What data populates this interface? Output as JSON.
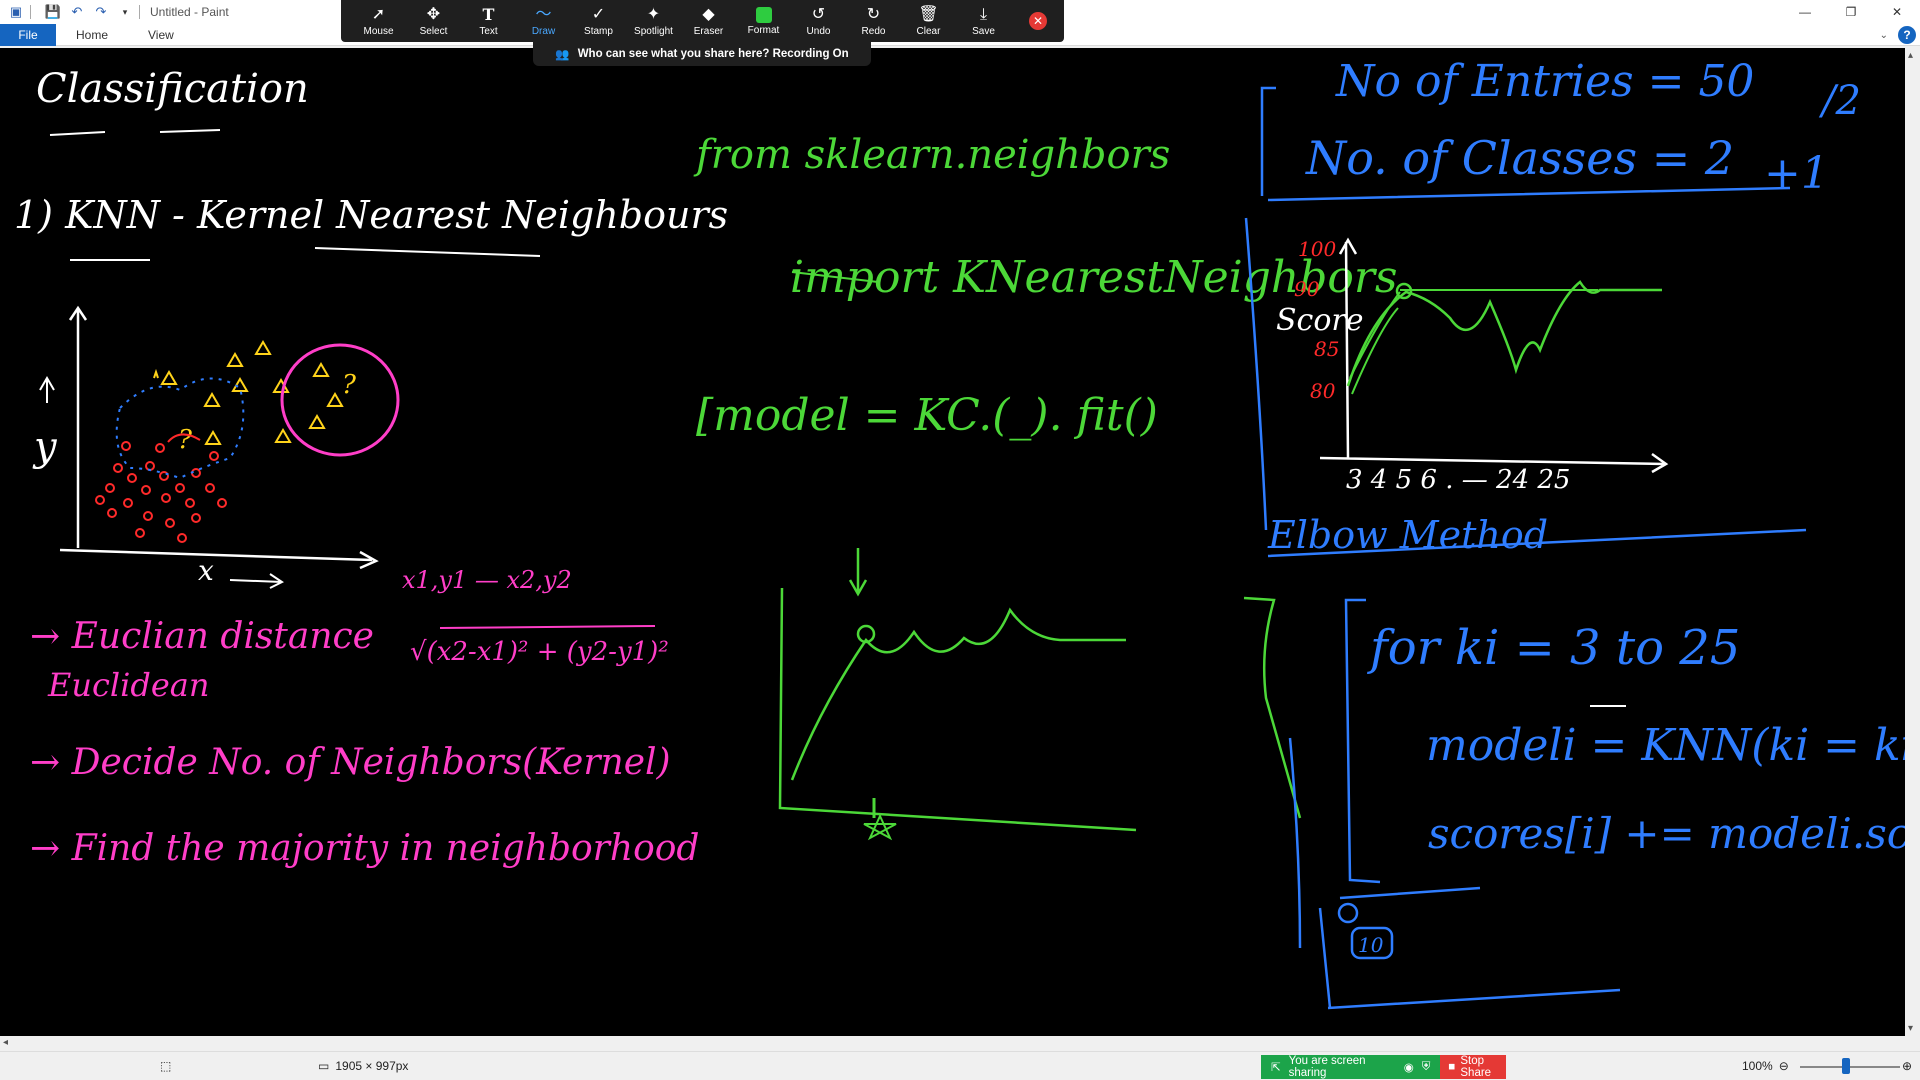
{
  "window": {
    "title": "Untitled - Paint",
    "controls": [
      "minimize",
      "restore",
      "close"
    ]
  },
  "ribbon": {
    "tabs": [
      "File",
      "Home",
      "View"
    ]
  },
  "zoom_toolbar": {
    "tools": [
      {
        "label": "Mouse",
        "icon": "cursor-icon"
      },
      {
        "label": "Select",
        "icon": "move-icon"
      },
      {
        "label": "Text",
        "icon": "text-icon"
      },
      {
        "label": "Draw",
        "icon": "draw-icon",
        "active": true
      },
      {
        "label": "Stamp",
        "icon": "stamp-icon"
      },
      {
        "label": "Spotlight",
        "icon": "spotlight-icon"
      },
      {
        "label": "Eraser",
        "icon": "eraser-icon"
      },
      {
        "label": "Format",
        "icon": "format-swatch-icon"
      },
      {
        "label": "Undo",
        "icon": "undo-icon"
      },
      {
        "label": "Redo",
        "icon": "redo-icon"
      },
      {
        "label": "Clear",
        "icon": "trash-icon"
      },
      {
        "label": "Save",
        "icon": "save-icon"
      }
    ],
    "sharing_notice": "Who can see what you share here? Recording On"
  },
  "canvas_text": {
    "heading": "Classification",
    "knn_title": "1) KNN - Kernel Nearest Neighbours",
    "axis_x": "x",
    "axis_y": "y",
    "coord_note": "x1,y1 — x2,y2",
    "bullet_1": "→ Euclian distance",
    "formula": "√(x2-x1)² + (y2-y1)²",
    "euclidean": "Euclidean",
    "bullet_2": "→ Decide No. of Neighbors(Kernel)",
    "bullet_3": "→ Find the majority in neighborhood",
    "code_1": "from sklearn.neighbors",
    "code_2": "import KNearestNeighbors",
    "code_3": "[model = KC.(_). fit()",
    "entries": "No of Entries = 50",
    "entries_note": "/2",
    "classes": "No. of Classes = 2",
    "classes_note": "+1",
    "score_label": "Score",
    "score_ticks": [
      "100",
      "90",
      "85",
      "80"
    ],
    "x_ticks": "3 4 5 6 . — 24 25",
    "elbow": "Elbow Method",
    "loop_1": "for ki = 3 to 25",
    "loop_2": "modeli = KNN(ki = ki)",
    "loop_3": "scores[i] += modeli.score()",
    "circled": "10"
  },
  "colors": {
    "ink_white": "#ffffff",
    "ink_pink": "#ff3ec8",
    "ink_green": "#4cd838",
    "ink_blue": "#2f7dff",
    "ink_yellow": "#ffd31a",
    "ink_red": "#ff2a2a"
  },
  "status": {
    "canvas_size": "1905 × 997px",
    "sharing": "You are screen sharing",
    "stop_share": "Stop Share",
    "zoom": "100%"
  }
}
